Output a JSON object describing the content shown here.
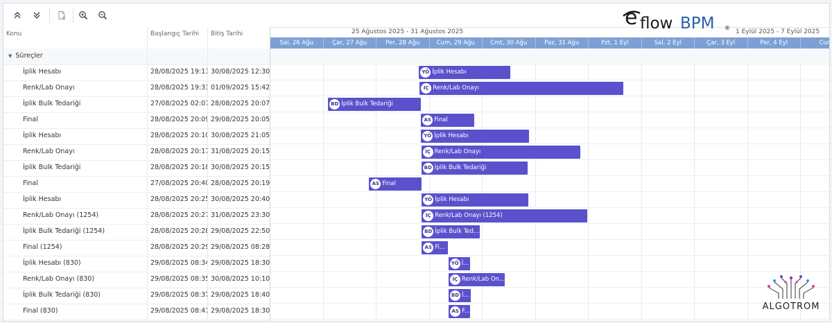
{
  "grid": {
    "columns": [
      "Konu",
      "Başlangıç Tarihi",
      "Bitiş Tarihi"
    ],
    "group_label": "Süreçler",
    "rows": [
      {
        "name": "İplik Hesabı",
        "start": "28/08/2025 19:13",
        "end": "30/08/2025 12:30"
      },
      {
        "name": "Renk/Lab Onayı",
        "start": "28/08/2025 19:31",
        "end": "01/09/2025 15:42"
      },
      {
        "name": "İplik Bulk Tedariği",
        "start": "27/08/2025 02:07",
        "end": "28/08/2025 20:07"
      },
      {
        "name": "Final",
        "start": "28/08/2025 20:09",
        "end": "29/08/2025 20:05"
      },
      {
        "name": "İplik Hesabı",
        "start": "28/08/2025 20:10",
        "end": "30/08/2025 21:05"
      },
      {
        "name": "Renk/Lab Onayı",
        "start": "28/08/2025 20:17",
        "end": "31/08/2025 20:15"
      },
      {
        "name": "İplik Bulk Tedariği",
        "start": "28/08/2025 20:18",
        "end": "30/08/2025 20:15"
      },
      {
        "name": "Final",
        "start": "27/08/2025 20:40",
        "end": "28/08/2025 20:19"
      },
      {
        "name": "İplik Hesabı",
        "start": "28/08/2025 20:25",
        "end": "30/08/2025 20:40"
      },
      {
        "name": "Renk/Lab Onayı (1254)",
        "start": "28/08/2025 20:27",
        "end": "31/08/2025 23:30"
      },
      {
        "name": "İplik Bulk Tedariği (1254)",
        "start": "28/08/2025 20:28",
        "end": "29/08/2025 22:50"
      },
      {
        "name": "Final (1254)",
        "start": "28/08/2025 20:29",
        "end": "29/08/2025 08:28"
      },
      {
        "name": "İplik Hesabı (830)",
        "start": "29/08/2025 08:34",
        "end": "29/08/2025 18:30"
      },
      {
        "name": "Renk/Lab Onayı (830)",
        "start": "29/08/2025 08:35",
        "end": "30/08/2025 10:10"
      },
      {
        "name": "İplik Bulk Tedariği (830)",
        "start": "29/08/2025 08:37",
        "end": "29/08/2025 18:40"
      },
      {
        "name": "Final (830)",
        "start": "29/08/2025 08:41",
        "end": "29/08/2025 18:30"
      }
    ]
  },
  "timeline": {
    "weeks": [
      "25 Ağustos 2025 - 31 Ağustos 2025",
      "1 Eylül 2025 - 7 Eylül 2025"
    ],
    "days": [
      "Sal, 26 Ağu",
      "Çar, 27 Ağu",
      "Per, 28 Ağu",
      "Cum, 29 Ağu",
      "Cmt, 30 Ağu",
      "Paz, 31 Ağu",
      "Pzt, 1 Eyl",
      "Sal, 2 Eyl",
      "Çar, 3 Eyl",
      "Per, 4 Eyl",
      "Cum,"
    ],
    "bars": [
      {
        "badge": "YÖ",
        "label": "İplik Hesabı"
      },
      {
        "badge": "İÇ",
        "label": "Renk/Lab Onayı"
      },
      {
        "badge": "BD",
        "label": "İplik Bulk Tedariği"
      },
      {
        "badge": "AS",
        "label": "Final"
      },
      {
        "badge": "YÖ",
        "label": "İplik Hesabı"
      },
      {
        "badge": "İÇ",
        "label": "Renk/Lab Onayı"
      },
      {
        "badge": "BD",
        "label": "İplik Bulk Tedariği"
      },
      {
        "badge": "AS",
        "label": "Final"
      },
      {
        "badge": "YÖ",
        "label": "İplik Hesabı"
      },
      {
        "badge": "İÇ",
        "label": "Renk/Lab Onayı (1254)"
      },
      {
        "badge": "BD",
        "label": "İplik Bulk Ted..."
      },
      {
        "badge": "AS",
        "label": "Fi..."
      },
      {
        "badge": "YÖ",
        "label": "İ..."
      },
      {
        "badge": "İÇ",
        "label": "Renk/Lab On..."
      },
      {
        "badge": "BD",
        "label": "İ..."
      },
      {
        "badge": "AS",
        "label": "F..."
      }
    ]
  },
  "logo": {
    "e": "e",
    "flow": "flow",
    "bpm": "BPM",
    "reg": "®"
  },
  "brand": {
    "name": "ALGOTROM"
  },
  "colors": {
    "bar": "#5b51cc",
    "day_header": "#7da0d4",
    "logo_blue": "#2b5fa8"
  }
}
